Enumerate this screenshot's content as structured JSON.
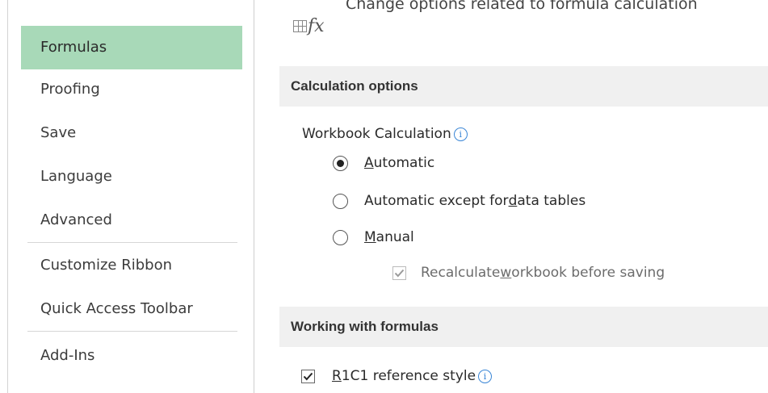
{
  "header": {
    "text": "Change options related to formula calculation"
  },
  "sidebar": {
    "items": [
      {
        "label": "Formulas",
        "selected": true
      },
      {
        "label": "Proofing"
      },
      {
        "label": "Save"
      },
      {
        "label": "Language"
      },
      {
        "label": "Advanced"
      },
      {
        "label": "Customize Ribbon"
      },
      {
        "label": "Quick Access Toolbar"
      },
      {
        "label": "Add-Ins"
      }
    ]
  },
  "calculation": {
    "section_title": "Calculation options",
    "workbook_label": "Workbook Calculation",
    "options": [
      {
        "pre": "",
        "key": "A",
        "post": "utomatic",
        "selected": true
      },
      {
        "pre": "Automatic except for ",
        "key": "d",
        "post": "ata tables",
        "selected": false
      },
      {
        "pre": "",
        "key": "M",
        "post": "anual",
        "selected": false
      }
    ],
    "recalc": {
      "pre": "Recalculate ",
      "key": "w",
      "post": "orkbook before saving",
      "checked": true,
      "disabled": true
    }
  },
  "formulas": {
    "section_title": "Working with formulas",
    "r1c1": {
      "pre": "",
      "key": "R",
      "post": "1C1 reference style",
      "checked": true
    }
  },
  "colors": {
    "selected_nav": "#a8d9b8",
    "section_bg": "#f0f0f0",
    "info": "#3a86d6"
  }
}
